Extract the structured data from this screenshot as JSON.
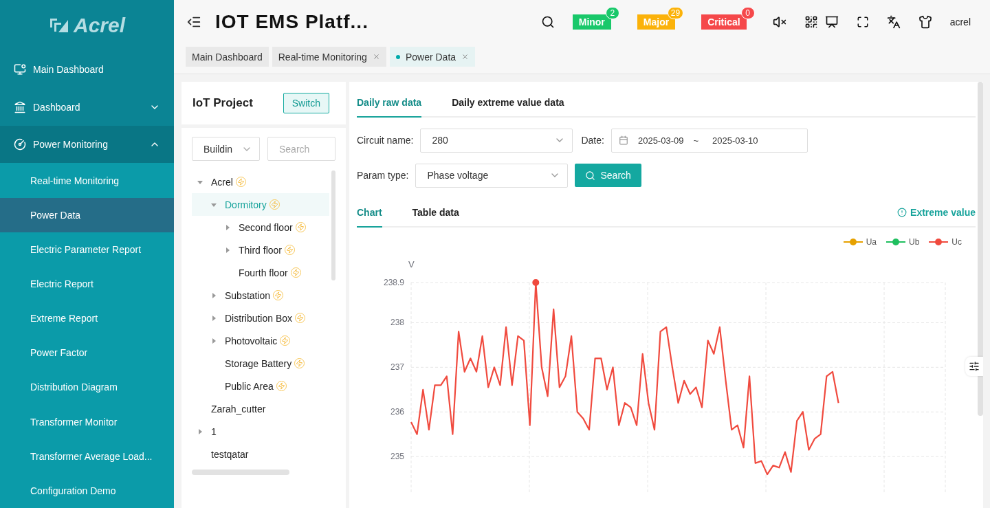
{
  "sidebar": {
    "logo": "Acrel",
    "items": [
      {
        "label": "Main Dashboard",
        "kind": "link"
      },
      {
        "label": "Dashboard",
        "kind": "group",
        "expanded": false
      },
      {
        "label": "Power Monitoring",
        "kind": "group",
        "expanded": true,
        "children": [
          {
            "label": "Real-time Monitoring",
            "selected": false
          },
          {
            "label": "Power Data",
            "selected": true
          },
          {
            "label": "Electric Parameter Report",
            "selected": false
          },
          {
            "label": "Electric Report",
            "selected": false
          },
          {
            "label": "Extreme Report",
            "selected": false
          },
          {
            "label": "Power Factor",
            "selected": false
          },
          {
            "label": "Distribution Diagram",
            "selected": false
          },
          {
            "label": "Transformer Monitor",
            "selected": false
          },
          {
            "label": "Transformer Average Load...",
            "selected": false
          },
          {
            "label": "Configuration Demo",
            "selected": false
          }
        ]
      }
    ]
  },
  "header": {
    "title": "IOT EMS Platf...",
    "alarms": [
      {
        "label": "Minor",
        "count": "2",
        "color": "#19c86a"
      },
      {
        "label": "Major",
        "count": "29",
        "color": "#fbb20a"
      },
      {
        "label": "Critical",
        "count": "0",
        "color": "#f5484a"
      }
    ],
    "user": "acrel"
  },
  "tabs": [
    {
      "label": "Main Dashboard",
      "selected": false,
      "closable": false
    },
    {
      "label": "Real-time Monitoring",
      "selected": false,
      "closable": true
    },
    {
      "label": "Power Data",
      "selected": true,
      "closable": true
    }
  ],
  "project": {
    "title": "IoT Project",
    "button": "Switch",
    "select": "Buildin",
    "search": {
      "placeholder": "Search"
    },
    "tree": [
      {
        "label": "Acrel",
        "powered": true,
        "selected": false,
        "expanded": true,
        "children": [
          {
            "label": "Dormitory",
            "powered": true,
            "selected": true,
            "expanded": true,
            "children": [
              {
                "label": "Second floor",
                "powered": true,
                "selected": false,
                "expanded": false
              },
              {
                "label": "Third floor",
                "powered": true,
                "selected": false,
                "expanded": false
              },
              {
                "label": "Fourth floor",
                "powered": true,
                "selected": false
              }
            ]
          },
          {
            "label": "Substation",
            "powered": true,
            "selected": false,
            "expanded": false
          },
          {
            "label": "Distribution Box",
            "powered": true,
            "selected": false,
            "expanded": false
          },
          {
            "label": "Photovoltaic",
            "powered": true,
            "selected": false,
            "expanded": false
          },
          {
            "label": "Storage Battery",
            "powered": true,
            "selected": false
          },
          {
            "label": "Public Area",
            "powered": true,
            "selected": false
          }
        ]
      },
      {
        "label": "Zarah_cutter",
        "powered": false,
        "selected": false
      },
      {
        "label": "1",
        "powered": false,
        "selected": false,
        "expanded": false
      },
      {
        "label": "testqatar",
        "powered": false,
        "selected": false
      }
    ]
  },
  "data": {
    "tabs": [
      {
        "label": "Daily raw data",
        "selected": true
      },
      {
        "label": "Daily extreme value data",
        "selected": false
      }
    ],
    "circuit": {
      "label": "Circuit name:",
      "value": "280"
    },
    "date": {
      "label": "Date:",
      "start": "2025-03-09",
      "separator": "~",
      "end": "2025-03-10"
    },
    "param": {
      "label": "Param type:",
      "value": "Phase voltage"
    },
    "search_button": "Search",
    "view_tabs": [
      {
        "label": "Chart",
        "selected": true
      },
      {
        "label": "Table data",
        "selected": false
      }
    ],
    "extreme_link": "Extreme value",
    "legend": [
      {
        "name": "Ua",
        "color": "#e6a100"
      },
      {
        "name": "Ub",
        "color": "#1fbf5f"
      }
    ],
    "chart_data": {
      "type": "line",
      "ylabel": "V",
      "grid": true,
      "ylim": [
        234.2,
        238.9
      ],
      "yticks": [
        {
          "value": 235,
          "label": "235"
        },
        {
          "value": 236,
          "label": "236"
        },
        {
          "value": 237,
          "label": "237"
        },
        {
          "value": 238,
          "label": "238"
        },
        {
          "value": 238.9,
          "label": "238.9"
        }
      ],
      "categories": [
        null,
        null,
        null,
        null,
        null,
        null,
        null,
        null,
        null,
        null,
        null,
        null,
        null,
        null,
        null,
        null,
        null,
        null,
        null,
        null,
        null,
        null,
        null,
        null,
        null,
        null,
        null,
        null,
        null,
        null,
        null,
        null,
        null,
        null,
        null,
        null,
        null,
        null,
        null,
        null,
        null,
        null,
        null,
        null,
        null,
        null,
        null,
        null,
        null,
        null,
        null,
        null,
        null,
        null,
        null,
        null,
        null,
        null,
        null,
        null,
        null,
        null,
        null,
        null,
        null,
        null,
        null,
        null,
        null,
        null,
        null,
        null,
        null,
        null,
        null,
        null,
        null,
        null,
        null,
        null,
        null,
        null,
        null,
        null,
        null,
        null,
        null,
        null,
        null,
        null,
        null
      ],
      "series": [
        {
          "name": "Uc",
          "color": "#f04a3e",
          "values": [
            235.77,
            235.5,
            236.5,
            235.6,
            236.6,
            236.6,
            236.8,
            235.5,
            237.8,
            236.9,
            237.2,
            236.9,
            237.7,
            236.55,
            237.0,
            236.6,
            237.9,
            236.6,
            237.7,
            237.6,
            235.7,
            238.9,
            237.0,
            236.35,
            238.3,
            236.55,
            236.8,
            237.7,
            236.0,
            235.85,
            235.6,
            237.2,
            237.2,
            236.5,
            237.0,
            235.7,
            236.2,
            236.1,
            235.7,
            237.3,
            236.2,
            235.6,
            237.8,
            237.9,
            237.0,
            236.2,
            236.7,
            236.4,
            236.55,
            236.1,
            237.6,
            237.3,
            237.9,
            236.7,
            235.6,
            235.7,
            235.2,
            236.8,
            234.85,
            234.9,
            234.6,
            234.8,
            234.75,
            235.1,
            234.65,
            235.8,
            236.0,
            235.15,
            235.4,
            235.5,
            236.8,
            236.9,
            236.2,
            null,
            null,
            null,
            null,
            null,
            null,
            null,
            null,
            null,
            null,
            null,
            null,
            null,
            null,
            null,
            null,
            null,
            null
          ]
        }
      ]
    }
  }
}
